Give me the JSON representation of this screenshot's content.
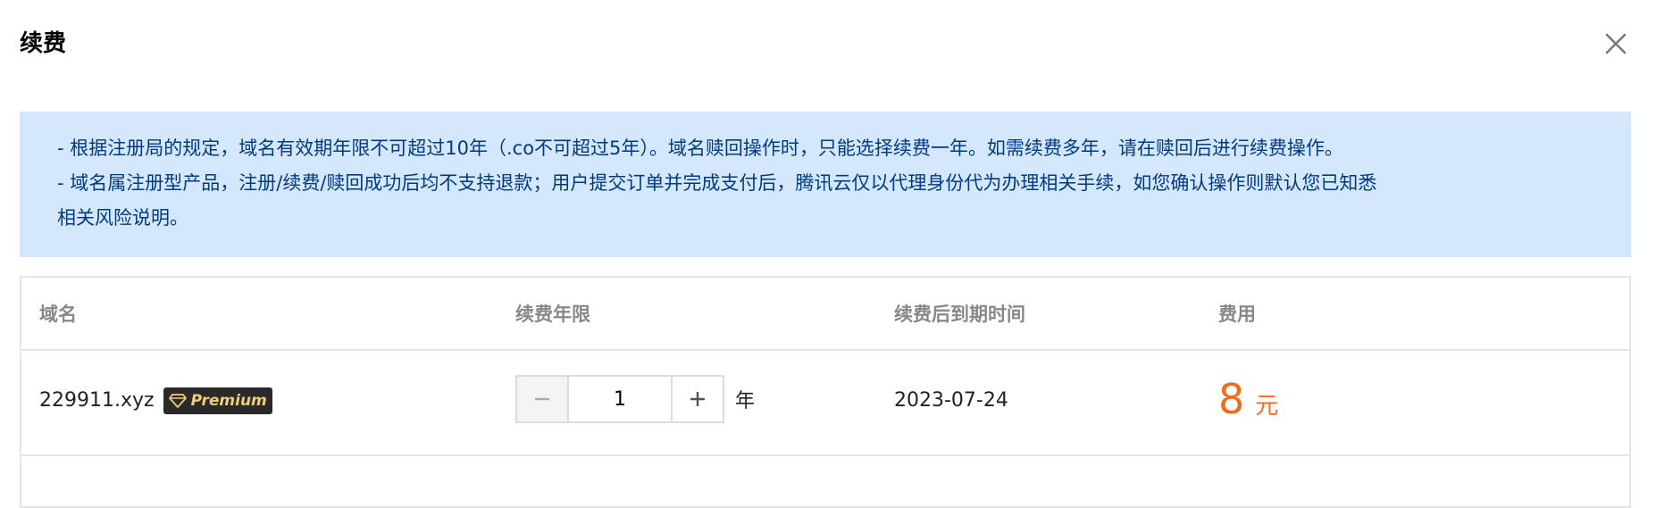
{
  "dialog": {
    "title": "续费",
    "close_icon": "close-icon"
  },
  "notice": {
    "line1": "- 根据注册局的规定，域名有效期年限不可超过10年（.co不可超过5年）。域名赎回操作时，只能选择续费一年。如需续费多年，请在赎回后进行续费操作。",
    "line2": "- 域名属注册型产品，注册/续费/赎回成功后均不支持退款；用户提交订单并完成支付后，腾讯云仅以代理身份代为办理相关手续，如您确认操作则默认您已知悉",
    "line3": "相关风险说明。"
  },
  "table": {
    "headers": {
      "domain": "域名",
      "years": "续费年限",
      "expiry": "续费后到期时间",
      "fee": "费用"
    },
    "rows": [
      {
        "domain": "229911.xyz",
        "badge": "Premium",
        "badge_icon": "diamond-icon",
        "years": "1",
        "years_unit": "年",
        "expiry": "2023-07-24",
        "fee": "8",
        "fee_unit": "元"
      }
    ]
  },
  "colors": {
    "notice_bg": "#d5e7fd",
    "notice_text": "#003b80",
    "price": "#f26c1e",
    "badge_bg": "#2a2a2a",
    "badge_text": "#f1cd7a"
  }
}
